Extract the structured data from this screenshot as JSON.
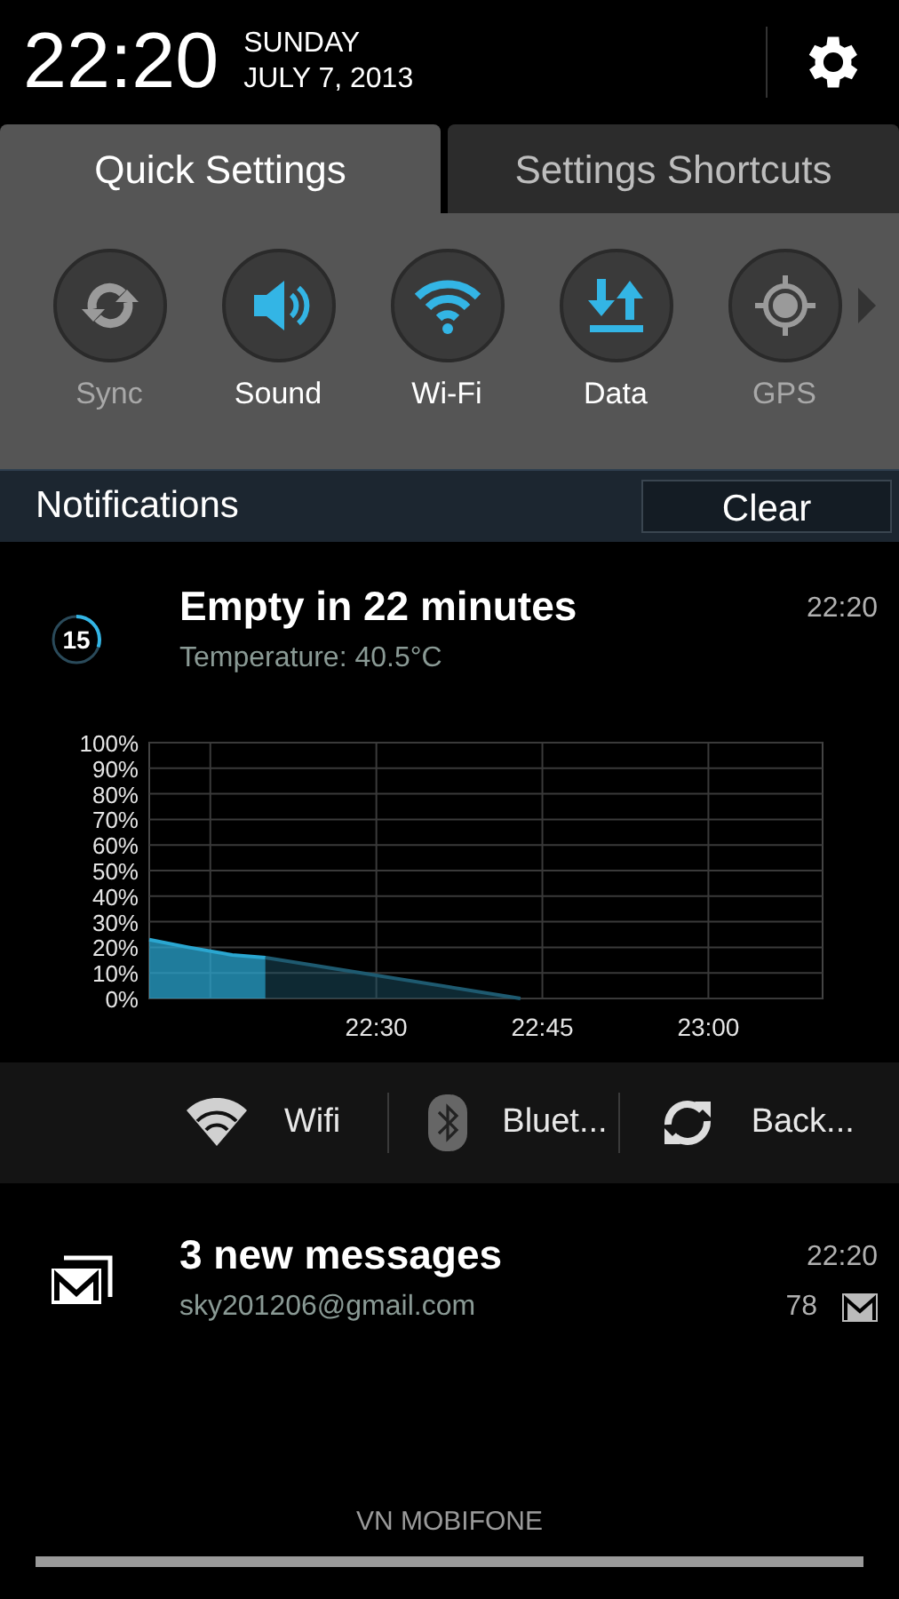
{
  "header": {
    "time": "22:20",
    "day": "SUNDAY",
    "date": "JULY 7, 2013"
  },
  "tabs": [
    {
      "label": "Quick Settings",
      "selected": true
    },
    {
      "label": "Settings Shortcuts",
      "selected": false
    }
  ],
  "toggles": [
    {
      "label": "Sync",
      "on": false
    },
    {
      "label": "Sound",
      "on": true
    },
    {
      "label": "Wi-Fi",
      "on": true
    },
    {
      "label": "Data",
      "on": true
    },
    {
      "label": "GPS",
      "on": false
    }
  ],
  "notifications_bar": {
    "title": "Notifications",
    "clear_button": "Clear"
  },
  "notifications": [
    {
      "kind": "battery",
      "badge": "15",
      "title": "Empty in 22 minutes",
      "subtitle": "Temperature: 40.5°C",
      "time": "22:20",
      "chart_data": {
        "type": "area",
        "grid": true,
        "x": [
          22.158,
          22.217,
          22.283,
          22.333,
          22.717
        ],
        "series": [
          {
            "color": "#2aa6d0",
            "values": [
              23,
              20,
              17,
              16,
              null
            ]
          },
          {
            "color": "#1e5a70",
            "values": [
              null,
              null,
              null,
              16,
              0
            ]
          }
        ],
        "xlim": [
          22.158,
          23.172
        ],
        "ylim": [
          0,
          100
        ],
        "xticks": [
          {
            "value": 22.5,
            "label": "22:30"
          },
          {
            "value": 22.75,
            "label": "22:45"
          },
          {
            "value": 23,
            "label": "23:00"
          }
        ],
        "yticks": [
          {
            "value": 0,
            "label": "0%"
          },
          {
            "value": 10,
            "label": "10%"
          },
          {
            "value": 20,
            "label": "20%"
          },
          {
            "value": 30,
            "label": "30%"
          },
          {
            "value": 40,
            "label": "40%"
          },
          {
            "value": 50,
            "label": "50%"
          },
          {
            "value": 60,
            "label": "60%"
          },
          {
            "value": 70,
            "label": "70%"
          },
          {
            "value": 80,
            "label": "80%"
          },
          {
            "value": 90,
            "label": "90%"
          },
          {
            "value": 100,
            "label": "100%"
          }
        ]
      },
      "actions": [
        {
          "label": "Wifi"
        },
        {
          "label": "Bluet..."
        },
        {
          "label": "Back..."
        }
      ]
    },
    {
      "kind": "mail",
      "title": "3 new messages",
      "subtitle": "sky201206@gmail.com",
      "time": "22:20",
      "count": "78"
    }
  ],
  "carrier": "VN MOBIFONE"
}
